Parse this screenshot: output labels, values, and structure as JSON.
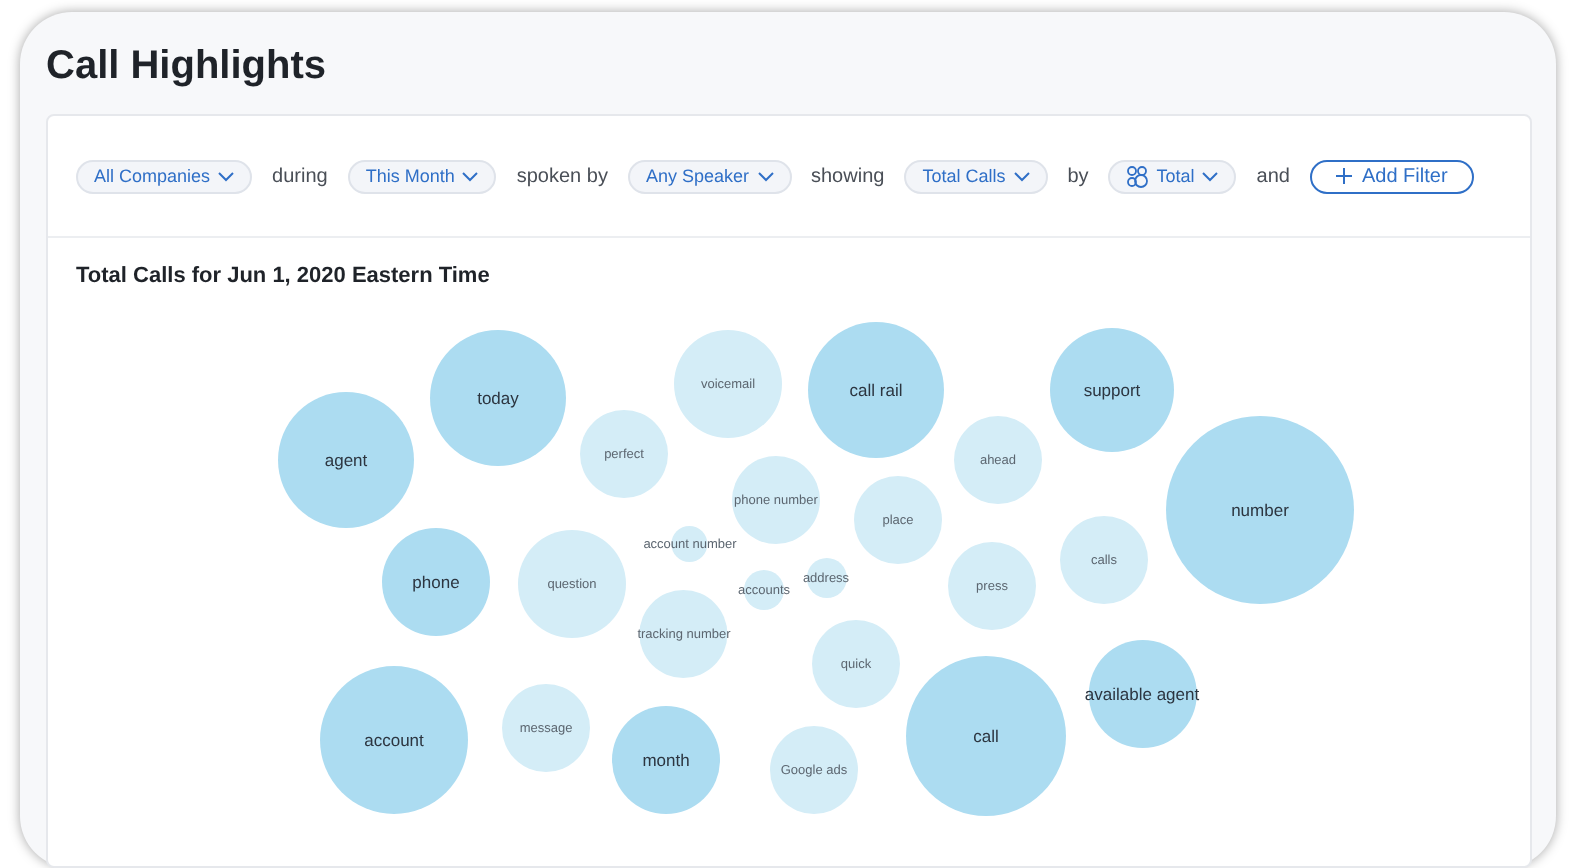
{
  "page": {
    "title": "Call Highlights"
  },
  "filters": [
    {
      "kind": "select",
      "label": "All Companies"
    },
    {
      "kind": "text",
      "label": "during"
    },
    {
      "kind": "select",
      "label": "This Month"
    },
    {
      "kind": "text",
      "label": "spoken by"
    },
    {
      "kind": "select",
      "label": "Any Speaker"
    },
    {
      "kind": "text",
      "label": "showing"
    },
    {
      "kind": "select",
      "label": "Total Calls"
    },
    {
      "kind": "text",
      "label": "by"
    },
    {
      "kind": "select",
      "label": "Total",
      "group_icon": true
    },
    {
      "kind": "text",
      "label": "and"
    },
    {
      "kind": "button",
      "label": "Add Filter"
    }
  ],
  "chart": {
    "title": "Total Calls for Jun 1, 2020 Eastern Time",
    "bubbles": [
      {
        "label": "agent",
        "kind": "major"
      },
      {
        "label": "today",
        "kind": "major"
      },
      {
        "label": "voicemail",
        "kind": "minor"
      },
      {
        "label": "call rail",
        "kind": "major"
      },
      {
        "label": "support",
        "kind": "major"
      },
      {
        "label": "perfect",
        "kind": "minor"
      },
      {
        "label": "ahead",
        "kind": "minor"
      },
      {
        "label": "phone number",
        "kind": "minor"
      },
      {
        "label": "place",
        "kind": "minor"
      },
      {
        "label": "number",
        "kind": "major"
      },
      {
        "label": "account number",
        "kind": "minor"
      },
      {
        "label": "phone",
        "kind": "major"
      },
      {
        "label": "question",
        "kind": "minor"
      },
      {
        "label": "accounts",
        "kind": "minor"
      },
      {
        "label": "address",
        "kind": "minor"
      },
      {
        "label": "press",
        "kind": "minor"
      },
      {
        "label": "calls",
        "kind": "minor"
      },
      {
        "label": "tracking number",
        "kind": "minor"
      },
      {
        "label": "quick",
        "kind": "minor"
      },
      {
        "label": "available agent",
        "kind": "major"
      },
      {
        "label": "account",
        "kind": "major"
      },
      {
        "label": "message",
        "kind": "minor"
      },
      {
        "label": "month",
        "kind": "major"
      },
      {
        "label": "Google ads",
        "kind": "minor"
      },
      {
        "label": "call",
        "kind": "major"
      }
    ]
  }
}
